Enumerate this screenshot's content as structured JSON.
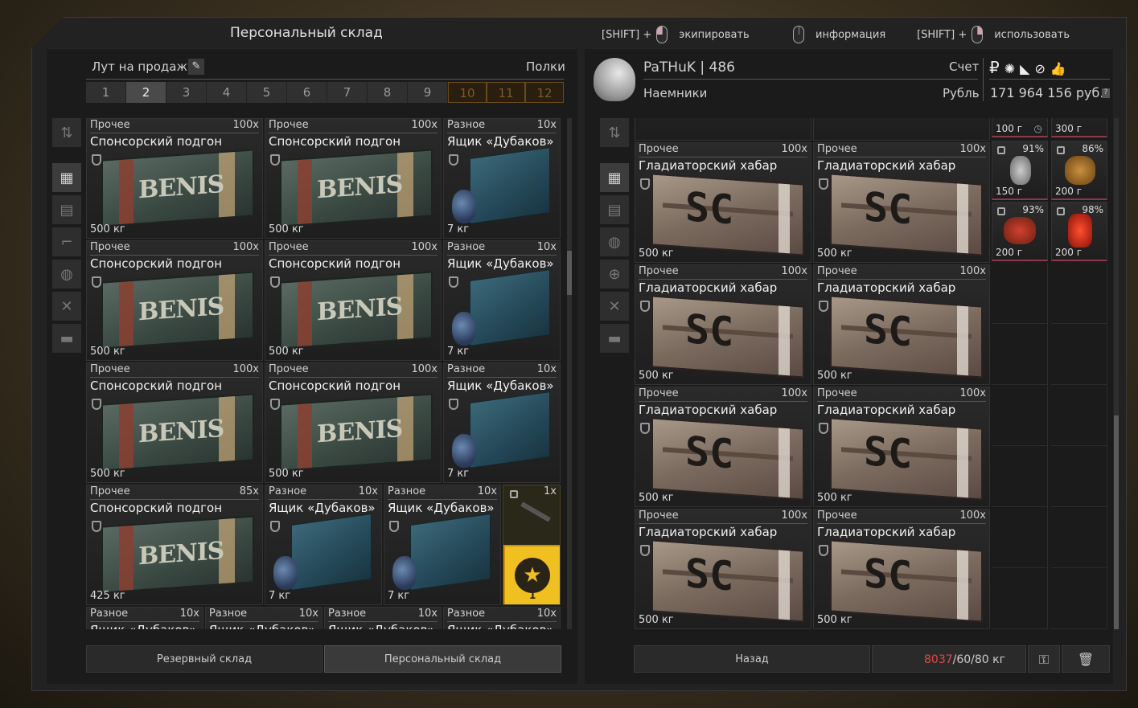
{
  "header": {
    "title": "Персональный склад",
    "hints": [
      {
        "key": "[SHIFT] +",
        "action": "экипировать"
      },
      {
        "key": "",
        "action": "информация"
      },
      {
        "key": "[SHIFT] +",
        "action": "использовать"
      }
    ]
  },
  "left": {
    "loot_label": "Лут на продажу",
    "shelves_label": "Полки",
    "tabs": [
      "1",
      "2",
      "3",
      "4",
      "5",
      "6",
      "7",
      "8",
      "9",
      "10",
      "11",
      "12"
    ],
    "active_tab": "2",
    "locked_tabs": [
      "10",
      "11",
      "12"
    ],
    "items": [
      {
        "cat": "Прочее",
        "cnt": "100x",
        "name": "Спонсорский подгон",
        "weight": "500 кг"
      },
      {
        "cat": "Прочее",
        "cnt": "100x",
        "name": "Спонсорский подгон",
        "weight": "500 кг"
      },
      {
        "cat": "Разное",
        "cnt": "10x",
        "name": "Ящик «Дубаков»",
        "weight": "7 кг"
      },
      {
        "cat": "Прочее",
        "cnt": "100x",
        "name": "Спонсорский подгон",
        "weight": "500 кг"
      },
      {
        "cat": "Прочее",
        "cnt": "100x",
        "name": "Спонсорский подгон",
        "weight": "500 кг"
      },
      {
        "cat": "Разное",
        "cnt": "10x",
        "name": "Ящик «Дубаков»",
        "weight": "7 кг"
      },
      {
        "cat": "Прочее",
        "cnt": "100x",
        "name": "Спонсорский подгон",
        "weight": "500 кг"
      },
      {
        "cat": "Прочее",
        "cnt": "100x",
        "name": "Спонсорский подгон",
        "weight": "500 кг"
      },
      {
        "cat": "Разное",
        "cnt": "10x",
        "name": "Ящик «Дубаков»",
        "weight": "7 кг"
      },
      {
        "cat": "Прочее",
        "cnt": "85x",
        "name": "Спонсорский подгон",
        "weight": "425 кг"
      },
      {
        "cat": "Разное",
        "cnt": "10x",
        "name": "Ящик «Дубаков»",
        "weight": "7 кг"
      },
      {
        "cat": "Разное",
        "cnt": "10x",
        "name": "Ящик «Дубаков»",
        "weight": "7 кг"
      }
    ],
    "special_cnt": "1x",
    "badge_number": "1",
    "partial_row": [
      {
        "cat": "Разное",
        "cnt": "10x",
        "name": "Ящик «Дубаков»"
      },
      {
        "cat": "Разное",
        "cnt": "10x",
        "name": "Ящик «Дубаков»"
      },
      {
        "cat": "Разное",
        "cnt": "10x",
        "name": "Ящик «Дубаков»"
      },
      {
        "cat": "Разное",
        "cnt": "10x",
        "name": "Ящик «Дубаков»"
      }
    ],
    "btn_reserve": "Резервный склад",
    "btn_personal": "Персональный склад"
  },
  "right": {
    "player_name": "PaTHuK",
    "player_level": "486",
    "faction": "Наемники",
    "account_label": "Счет",
    "currency_label": "Рубль",
    "balance": "171 964 156 руб.",
    "items": [
      {
        "cat": "Прочее",
        "cnt": "100x",
        "name": "Гладиаторский хабар",
        "weight": "500 кг"
      },
      {
        "cat": "Прочее",
        "cnt": "100x",
        "name": "Гладиаторский хабар",
        "weight": "500 кг"
      },
      {
        "cat": "Прочее",
        "cnt": "100x",
        "name": "Гладиаторский хабар",
        "weight": "500 кг"
      },
      {
        "cat": "Прочее",
        "cnt": "100x",
        "name": "Гладиаторский хабар",
        "weight": "500 кг"
      },
      {
        "cat": "Прочее",
        "cnt": "100x",
        "name": "Гладиаторский хабар",
        "weight": "500 кг"
      },
      {
        "cat": "Прочее",
        "cnt": "100x",
        "name": "Гладиаторский хабар",
        "weight": "500 кг"
      },
      {
        "cat": "Прочее",
        "cnt": "100x",
        "name": "Гладиаторский хабар",
        "weight": "500 кг"
      },
      {
        "cat": "Прочее",
        "cnt": "100x",
        "name": "Гладиаторский хабар",
        "weight": "500 кг"
      }
    ],
    "small_items": [
      {
        "pct": "",
        "price": "100 г"
      },
      {
        "pct": "",
        "price": "300 г"
      },
      {
        "pct": "91%",
        "price": "150 г"
      },
      {
        "pct": "86%",
        "price": "200 г"
      },
      {
        "pct": "93%",
        "price": "200 г"
      },
      {
        "pct": "98%",
        "price": "200 г"
      }
    ],
    "btn_back": "Назад",
    "weight_current": "8037",
    "weight_limits": "/60/80 кг"
  },
  "colors": {
    "accent_red": "#e04848",
    "badge_gold": "#f0c020",
    "locked_tab": "#6a4a1a"
  }
}
